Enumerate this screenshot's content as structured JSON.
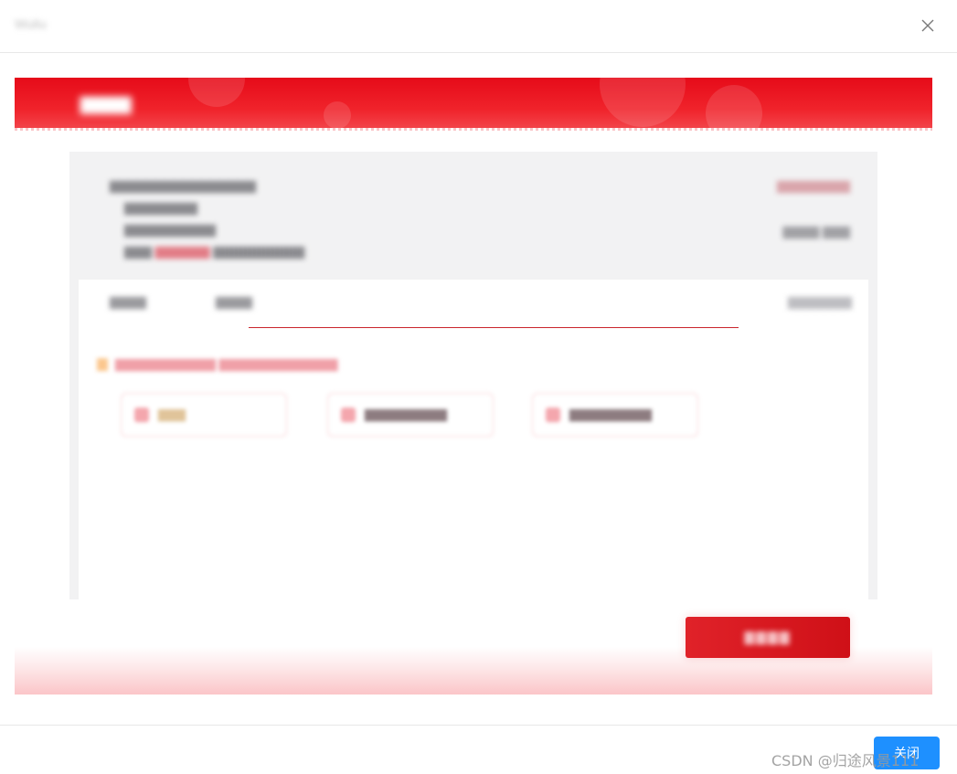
{
  "dialog": {
    "title": "Wuliu",
    "close_glyph": "×",
    "close_icon": "close-icon"
  },
  "banner": {
    "title": "▇▇▇▇",
    "accent_color": "#e60b19"
  },
  "order_info": {
    "line1": "▇▇▇▇▇▇▇▇▇▇▇▇▇▇▇▇",
    "line2": "▇▇▇▇▇▇▇▇",
    "line3": "▇▇▇▇▇▇▇▇▇▇",
    "line4a": "▇▇▇",
    "line4b": "▇▇▇▇▇▇",
    "line4c": "▇▇▇▇▇▇▇▇▇▇",
    "right1": "▇▇▇▇▇▇▇▇",
    "right2": "▇▇▇▇ ▇▇▇"
  },
  "tabs": {
    "items": [
      "▇▇▇▇",
      "▇▇▇▇"
    ],
    "extra": "▇▇▇▇▇▇▇"
  },
  "notice": "▇▇▇▇▇▇▇▇▇▇▇ ▇▇▇▇▇▇▇▇▇▇▇▇▇",
  "options": [
    {
      "label": "▇▇▇"
    },
    {
      "label": "▇▇▇▇▇▇▇▇▇"
    },
    {
      "label": "▇▇▇▇▇▇▇▇▇"
    }
  ],
  "submit_label": "▇▇▇▇",
  "footer": {
    "button_label": "关闭",
    "watermark": "CSDN @归途风景111"
  }
}
